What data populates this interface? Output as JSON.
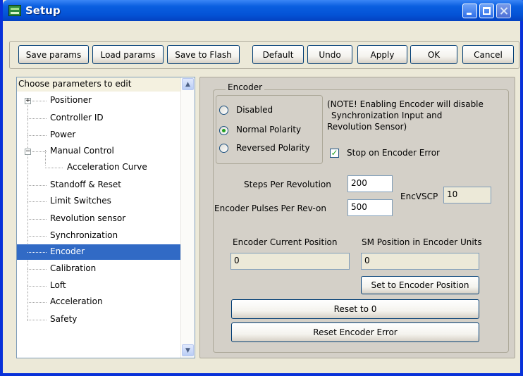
{
  "window": {
    "title": "Setup"
  },
  "toolbar": {
    "save_params": "Save params",
    "load_params": "Load params",
    "save_flash": "Save to Flash",
    "default": "Default",
    "undo": "Undo",
    "apply": "Apply",
    "ok": "OK",
    "cancel": "Cancel"
  },
  "tree": {
    "header": "Choose parameters to edit",
    "items": [
      {
        "label": "Positioner",
        "expander": "+"
      },
      {
        "label": "Controller ID"
      },
      {
        "label": "Power"
      },
      {
        "label": "Manual Control",
        "expander": "−"
      },
      {
        "label": "Acceleration Curve"
      },
      {
        "label": "Standoff & Reset"
      },
      {
        "label": "Limit Switches"
      },
      {
        "label": "Revolution sensor"
      },
      {
        "label": "Synchronization"
      },
      {
        "label": "Encoder",
        "selected": true
      },
      {
        "label": "Calibration"
      },
      {
        "label": "Loft"
      },
      {
        "label": "Acceleration"
      },
      {
        "label": "Safety"
      }
    ]
  },
  "encoder": {
    "group_title": "Encoder",
    "modes": {
      "disabled": "Disabled",
      "normal": "Normal Polarity",
      "reversed": "Reversed Polarity",
      "selected": "Normal Polarity"
    },
    "note_line1": "(NOTE! Enabling Encoder will disable",
    "note_line2": "Synchronization Input and",
    "note_line3": "Revolution Sensor)",
    "stop_on_error_label": "Stop on Encoder Error",
    "stop_on_error_checked": true,
    "steps_per_rev_label": "Steps Per Revolution",
    "steps_per_rev_value": "200",
    "pulses_per_rev_label": "Encoder Pulses Per Rev-on",
    "pulses_per_rev_value": "500",
    "encvscp_label": "EncVSCP",
    "encvscp_value": "10",
    "current_position_label": "Encoder Current Position",
    "current_position_value": "0",
    "sm_position_label": "SM Position in Encoder Units",
    "sm_position_value": "0",
    "set_position_button": "Set to Encoder Position",
    "reset_button": "Reset to 0",
    "reset_error_button": "Reset Encoder Error"
  },
  "colors": {
    "titlebar": "#0453d6",
    "selection": "#316ac5",
    "panel": "#d4d0c8",
    "window": "#ece9d8"
  }
}
